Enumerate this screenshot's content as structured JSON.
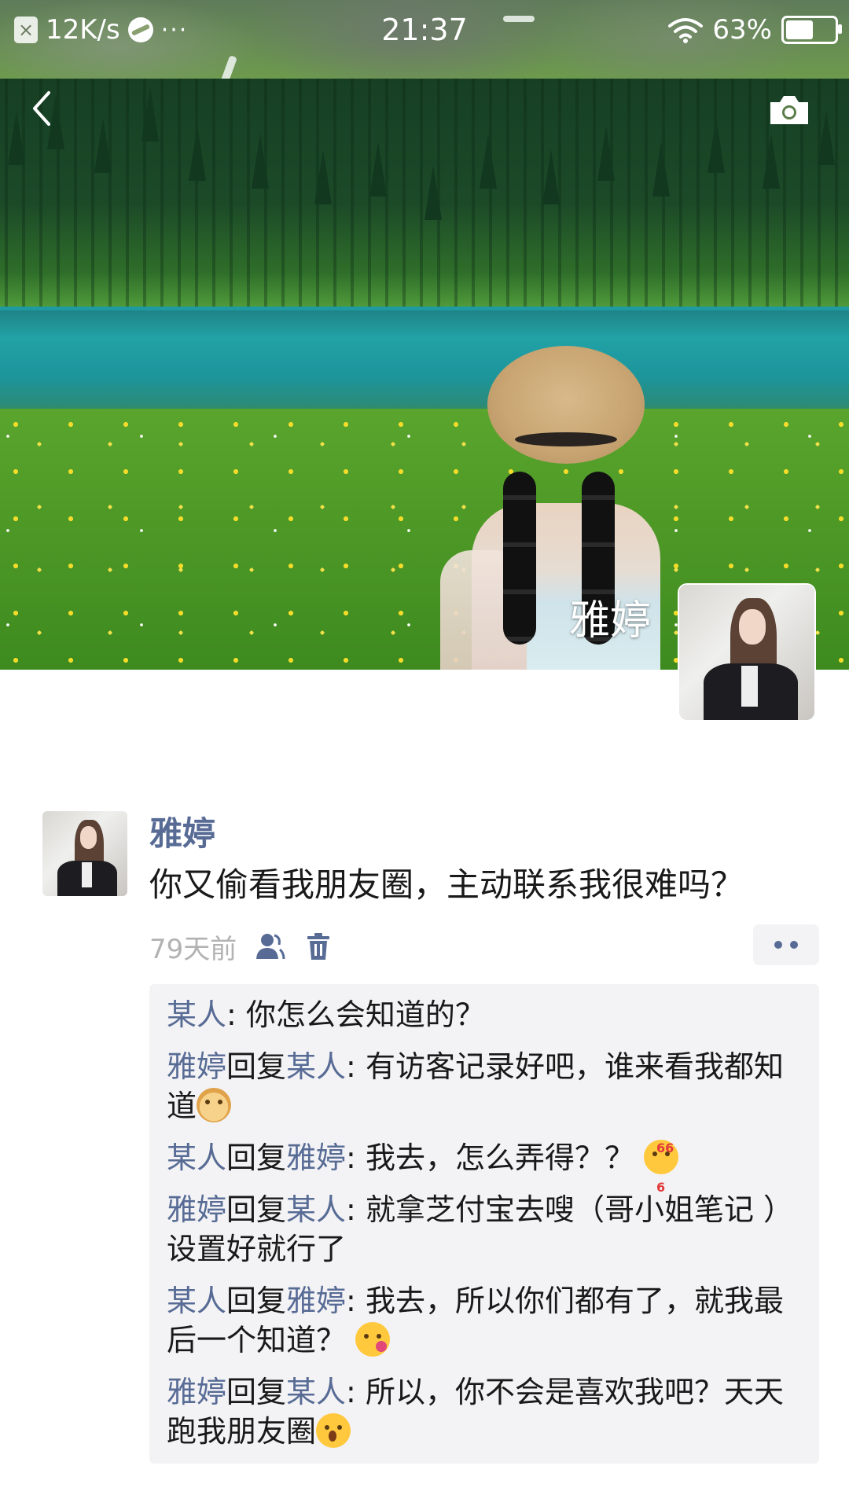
{
  "status_bar": {
    "net_speed": "12K/s",
    "dots": "···",
    "time": "21:37",
    "battery": "63%",
    "battery_level": 0.63
  },
  "cover": {
    "user_name": "雅婷"
  },
  "nav": {
    "back_icon": "chevron-left-icon",
    "camera_icon": "camera-icon"
  },
  "post": {
    "author": "雅婷",
    "text": "你又偷看我朋友圈，主动联系我很难吗？",
    "time_ago": "79天前",
    "visibility_icon": "friends-icon",
    "delete_icon": "trash-icon",
    "more_icon": "more-dots-icon"
  },
  "comments": [
    {
      "from": "某人",
      "reply_word": "",
      "to": "",
      "text": "你怎么会知道的？",
      "emoji": ""
    },
    {
      "from": "雅婷",
      "reply_word": "回复",
      "to": "某人",
      "text": "有访客记录好吧，谁来看我都知道",
      "emoji": "doge"
    },
    {
      "from": "某人",
      "reply_word": "回复",
      "to": "雅婷",
      "text": "我去，怎么弄得？？",
      "emoji": "666"
    },
    {
      "from": "雅婷",
      "reply_word": "回复",
      "to": "某人",
      "text": "就拿芝付宝去嗖（哥小姐笔记 ）设置好就行了",
      "emoji": ""
    },
    {
      "from": "某人",
      "reply_word": "回复",
      "to": "雅婷",
      "text": "我去，所以你们都有了，就我最后一个知道？",
      "emoji": "kiss"
    },
    {
      "from": "雅婷",
      "reply_word": "回复",
      "to": "某人",
      "text": "所以，你不会是喜欢我吧？天天跑我朋友圈",
      "emoji": "shock"
    }
  ],
  "emoji_labels": {
    "666": "666"
  },
  "colors": {
    "name_blue": "#576b95",
    "comment_bg": "#f3f3f5",
    "time_gray": "#b2b2b2"
  }
}
